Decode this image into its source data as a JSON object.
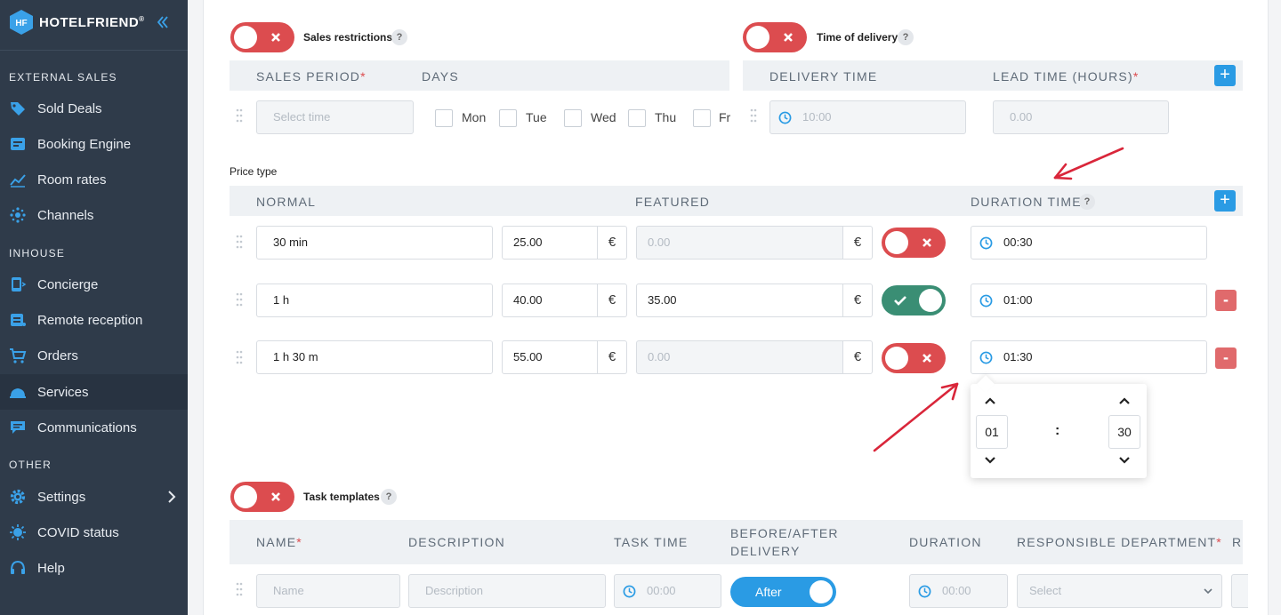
{
  "brand": {
    "name": "HOTELFRIEND",
    "reg": "®",
    "logo_text": "HF"
  },
  "sidebar": {
    "sections": {
      "external": "EXTERNAL SALES",
      "inhouse": "INHOUSE",
      "other": "OTHER"
    },
    "items": [
      {
        "label": "Sold Deals",
        "icon": "tag-icon"
      },
      {
        "label": "Booking Engine",
        "icon": "booking-engine-icon"
      },
      {
        "label": "Room rates",
        "icon": "chart-icon"
      },
      {
        "label": "Channels",
        "icon": "channels-icon"
      },
      {
        "label": "Concierge",
        "icon": "concierge-icon"
      },
      {
        "label": "Remote reception",
        "icon": "remote-reception-icon"
      },
      {
        "label": "Orders",
        "icon": "cart-icon"
      },
      {
        "label": "Services",
        "icon": "cloud-icon",
        "active": true
      },
      {
        "label": "Communications",
        "icon": "chat-icon"
      },
      {
        "label": "Settings",
        "icon": "gear-icon"
      },
      {
        "label": "COVID status",
        "icon": "virus-icon"
      },
      {
        "label": "Help",
        "icon": "help-icon"
      }
    ]
  },
  "sales": {
    "toggle_label": "Sales restrictions",
    "help": "?",
    "col_period": "SALES PERIOD",
    "col_days": "DAYS",
    "req": "*",
    "period_placeholder": "Select time",
    "days": [
      "Mon",
      "Tue",
      "Wed",
      "Thu",
      "Fr"
    ]
  },
  "delivery": {
    "toggle_label": "Time of delivery",
    "help": "?",
    "col_time": "DELIVERY TIME",
    "col_lead": "LEAD TIME (HOURS)",
    "req": "*",
    "time_placeholder": "10:00",
    "lead_placeholder": "0.00",
    "add": "+"
  },
  "price": {
    "title": "Price type",
    "col_normal": "NORMAL",
    "col_featured": "FEATURED",
    "col_duration": "DURATION TIME",
    "help": "?",
    "add": "+",
    "currency": "€",
    "remove": "-",
    "rows": [
      {
        "name": "30 min",
        "normal": "25.00",
        "featured": "",
        "featured_placeholder": "0.00",
        "featured_on": false,
        "duration": "00:30"
      },
      {
        "name": "1 h",
        "normal": "40.00",
        "featured": "35.00",
        "featured_placeholder": "0.00",
        "featured_on": true,
        "duration": "01:00"
      },
      {
        "name": "1 h 30 m",
        "normal": "55.00",
        "featured": "",
        "featured_placeholder": "0.00",
        "featured_on": false,
        "duration": "01:30"
      }
    ]
  },
  "picker": {
    "hours": "01",
    "minutes": "30",
    "separator": ":"
  },
  "tasks": {
    "toggle_label": "Task templates",
    "help": "?",
    "col_name": "NAME",
    "col_desc": "DESCRIPTION",
    "col_time": "TASK TIME",
    "col_before_1": "BEFORE/AFTER",
    "col_before_2": "DELIVERY",
    "col_duration": "DURATION",
    "col_dept": "RESPONSIBLE DEPARTMENT",
    "col_extra": "RE",
    "req": "*",
    "name_placeholder": "Name",
    "desc_placeholder": "Description",
    "time_placeholder": "00:00",
    "after_label": "After",
    "duration_placeholder": "00:00",
    "dept_placeholder": "Select"
  },
  "colors": {
    "sidebar": "#2f3b4a",
    "accent": "#2a9be4",
    "toggle_off": "#dc4c4f",
    "toggle_on": "#3a8e74",
    "annotation": "#d9263a"
  }
}
